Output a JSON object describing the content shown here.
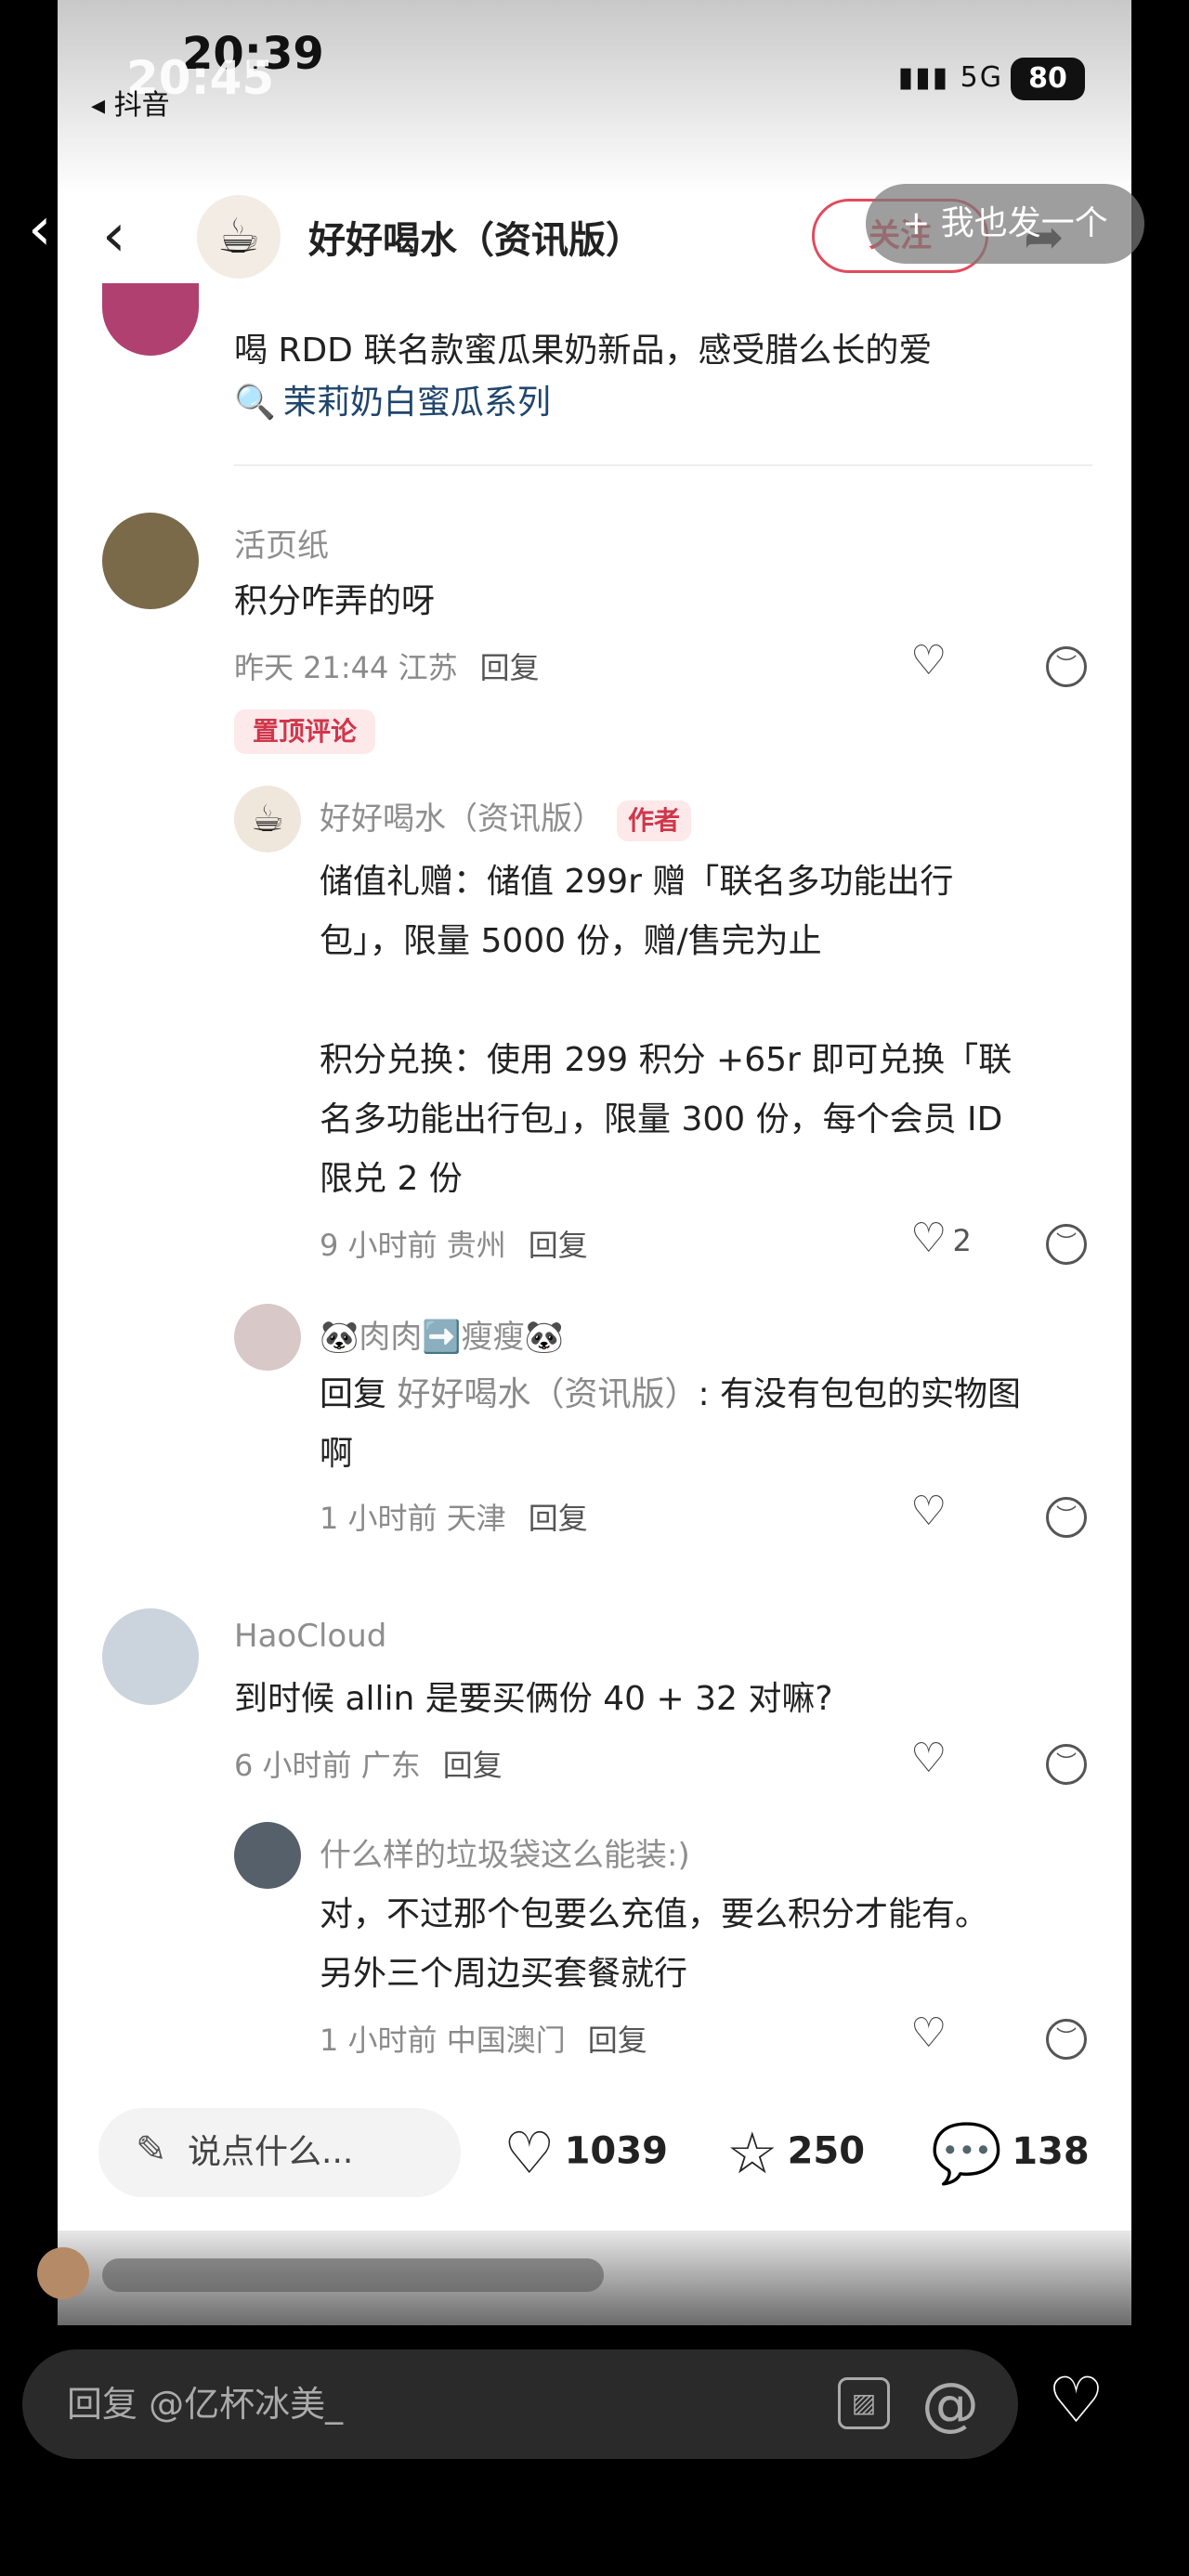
{
  "status_bar": {
    "time_back": "20:39",
    "time_front": "20:45",
    "back_app": "◂ 抖音",
    "signal": "5G",
    "battery": "80"
  },
  "nav": {
    "account_name": "好好喝水（资讯版）",
    "follow_label": "关注",
    "post_pill": "+ 我也发一个"
  },
  "post": {
    "excerpt": "喝 RDD 联名款蜜瓜果奶新品，感受腊么长的爱",
    "topic_link": "茉莉奶白蜜瓜系列"
  },
  "comments": [
    {
      "name": "活页纸",
      "text": "积分咋弄的呀",
      "meta": "昨天 21:44 江苏",
      "reply": "回复",
      "pin_label": "置顶评论"
    },
    {
      "name": "好好喝水（资讯版）",
      "author_tag": "作者",
      "lines": [
        "储值礼赠：储值 299r 赠「联名多功能出行",
        "包」，限量 5000 份，赠/售完为止",
        "",
        "积分兑换：使用 299 积分 +65r 即可兑换「联",
        "名多功能出行包」，限量 300 份，每个会员 ID",
        "限兑 2 份"
      ],
      "meta": "9 小时前 贵州",
      "reply": "回复",
      "likes": "2"
    },
    {
      "name": "🐼肉肉➡️瘦瘦🐼",
      "reply_prefix": "回复",
      "reply_to": "好好喝水（资讯版）",
      "text1": ": 有没有包包的实物图",
      "text2": "啊",
      "meta": "1 小时前 天津",
      "reply": "回复"
    },
    {
      "name": "HaoCloud",
      "text": "到时候 allin 是要买俩份 40 + 32 对嘛?",
      "meta": "6 小时前 广东",
      "reply": "回复"
    },
    {
      "name": "什么样的垃圾袋这么能装:)",
      "lines": [
        "对，不过那个包要么充值，要么积分才能有。",
        "另外三个周边买套餐就行"
      ],
      "meta": "1 小时前 中国澳门",
      "reply": "回复"
    }
  ],
  "bottom_bar": {
    "say_placeholder": "说点什么...",
    "likes": "1039",
    "favorites": "250",
    "comments": "138"
  },
  "composer": {
    "placeholder": "回复 @亿杯冰美_"
  },
  "icons": {
    "like": "heart-icon",
    "dislike": "dislike-face-icon",
    "favorite": "star-icon",
    "comment": "chat-bubble-icon",
    "image": "image-icon",
    "mention": "at-icon"
  },
  "colors": {
    "accent": "#e14b5c",
    "link": "#20456c",
    "author_tag_bg": "#fde8ea"
  }
}
